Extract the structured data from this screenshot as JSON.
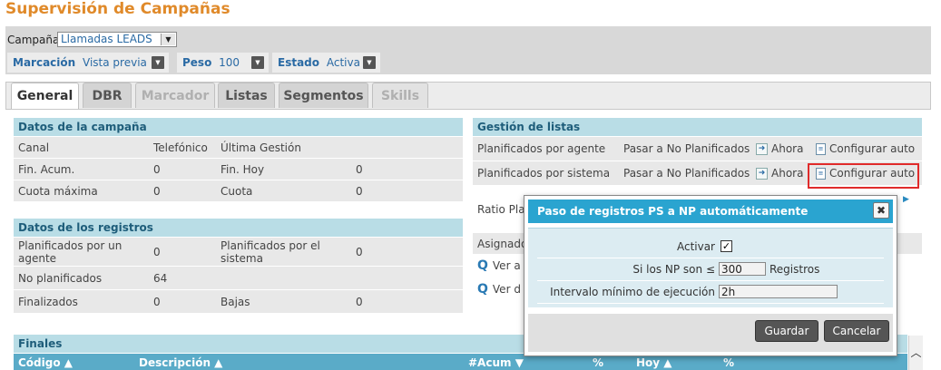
{
  "page": {
    "title": "Supervisión de Campañas"
  },
  "filters": {
    "campana_label": "Campaña",
    "campana_value": "Llamadas LEADS",
    "marcacion_label": "Marcación",
    "marcacion_value": "Vista previa",
    "peso_label": "Peso",
    "peso_value": "100",
    "estado_label": "Estado",
    "estado_value": "Activa"
  },
  "tabs": [
    {
      "label": "General",
      "state": "active"
    },
    {
      "label": "DBR",
      "state": "normal"
    },
    {
      "label": "Marcador",
      "state": "disabled"
    },
    {
      "label": "Listas",
      "state": "normal"
    },
    {
      "label": "Segmentos",
      "state": "normal"
    },
    {
      "label": "Skills",
      "state": "disabled"
    }
  ],
  "datos_campana": {
    "title": "Datos de la campaña",
    "rows": [
      [
        "Canal",
        "Telefónico",
        "Última Gestión",
        ""
      ],
      [
        "Fin. Acum.",
        "0",
        "Fin. Hoy",
        "0"
      ],
      [
        "Cuota máxima",
        "0",
        "Cuota",
        "0"
      ]
    ]
  },
  "datos_registros": {
    "title": "Datos de los registros",
    "rows": [
      [
        "Planificados por un agente",
        "0",
        "Planificados por el sistema",
        "0"
      ],
      [
        "No planificados",
        "64",
        "",
        ""
      ],
      [
        "Finalizados",
        "0",
        "Bajas",
        "0"
      ]
    ]
  },
  "gestion_listas": {
    "title": "Gestión de listas",
    "rows": [
      {
        "label": "Planificados por agente",
        "action": "Pasar a No Planificados",
        "now": "Ahora",
        "auto": "Configurar auto"
      },
      {
        "label": "Planificados por sistema",
        "action": "Pasar a No Planificados",
        "now": "Ahora",
        "auto": "Configurar auto"
      }
    ],
    "ratio_label": "Ratio Pla",
    "asignado_label": "Asignado",
    "ver_1": "Ver a",
    "ver_2": "Ver d"
  },
  "finales": {
    "title": "Finales",
    "columns": [
      "Código",
      "Descripción",
      "#Acum",
      "%",
      "Hoy",
      "%"
    ]
  },
  "icons": {
    "dropdown": "chevron-down-icon",
    "arrow": "arrow-right-icon",
    "doc": "document-icon",
    "search": "search-icon",
    "check": "check-icon",
    "close": "close-icon"
  },
  "modal": {
    "title": "Paso de registros PS a NP automáticamente",
    "close": "✖",
    "activar_label": "Activar",
    "activar_checked": true,
    "np_label": "Si los NP son ≤",
    "np_value": "300",
    "np_unit": "Registros",
    "intervalo_label": "Intervalo mínimo de ejecución",
    "intervalo_value": "2h",
    "save": "Guardar",
    "cancel": "Cancelar"
  },
  "colors": {
    "title": "#e08a2a",
    "panel_header": "#b9dde6",
    "modal_header": "#2aa4d0",
    "table_header": "#5aabc8",
    "highlight": "#e02b2b"
  }
}
